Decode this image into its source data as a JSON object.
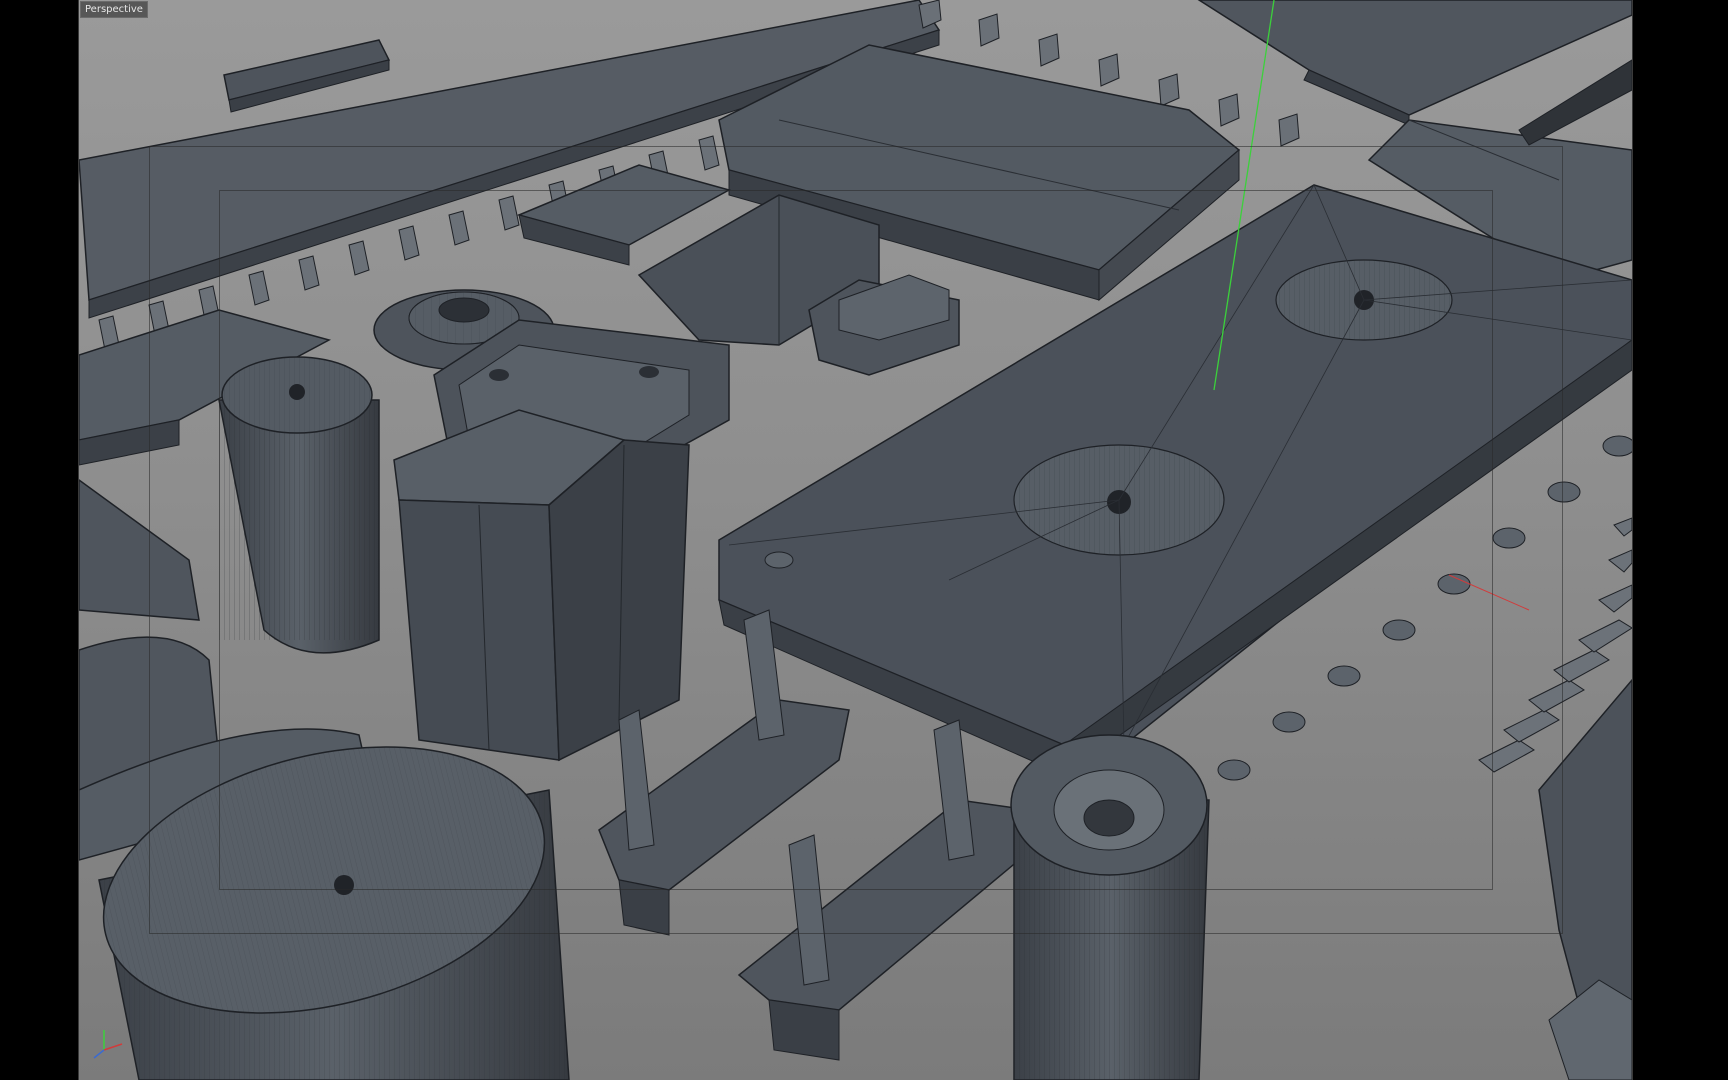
{
  "viewport": {
    "label": "Perspective"
  },
  "colors": {
    "background_top": "#9a9a9a",
    "background_bottom": "#7b7b7b",
    "surface": "#4a5058",
    "surface_light": "#5b626b",
    "surface_dark": "#383d44",
    "wire": "#1e2126",
    "axis_y": "#3bd13b",
    "axis_x": "#d13b3b",
    "axis_z": "#3b6bd1"
  },
  "icons": {
    "axis_gizmo": "axis-gizmo-icon"
  }
}
